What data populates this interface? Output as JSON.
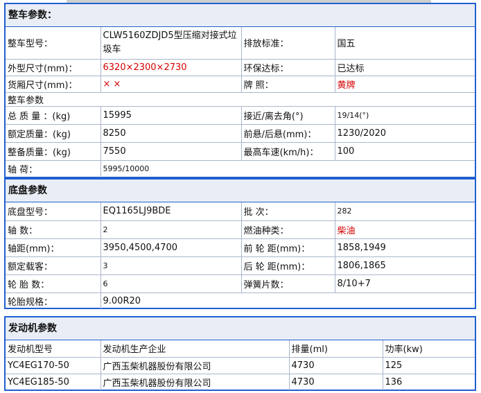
{
  "vehicle": {
    "title": "整车参数：",
    "model_label": "整车型号：",
    "model_value": "CLW5160ZDJD5型压缩对接式垃圾车",
    "emission_label": "排放标准：",
    "emission_value": "国五",
    "dims_label": "外型尺寸(mm)：",
    "dims_value": "6320×2300×2730",
    "env_label": "环保达标：",
    "env_value": "已达标",
    "box_label": "货厢尺寸(mm)：",
    "box_value": "× ×",
    "plate_label": "牌 照：",
    "plate_value": "黄牌",
    "sub_heading": "整车参数",
    "total_mass_label": "总 质 量 ：(kg)",
    "total_mass_value": "15995",
    "angle_label": "接近/离去角(°)",
    "angle_value": "19/14(°)",
    "rated_mass_label": "额定质量：(kg)",
    "rated_mass_value": "8250",
    "overhang_label": "前悬/后悬(mm)：",
    "overhang_value": "1230/2020",
    "curb_mass_label": "整备质量：(kg)",
    "curb_mass_value": "7550",
    "speed_label": "最高车速(km/h)：",
    "speed_value": "100",
    "axle_load_label": "轴 荷：",
    "axle_load_value": "5995/10000"
  },
  "chassis": {
    "title": "底盘参数",
    "model_label": "底盘型号：",
    "model_value": "EQ1165LJ9BDE",
    "batch_label": "批 次：",
    "batch_value": "282",
    "axles_label": "轴 数：",
    "axles_value": "2",
    "fuel_label": "燃油种类：",
    "fuel_value": "柴油",
    "wheelbase_label": "轴距(mm)：",
    "wheelbase_value": "3950,4500,4700",
    "front_track_label": "前 轮 距(mm)：",
    "front_track_value": "1858,1949",
    "passengers_label": "额定载客：",
    "passengers_value": "3",
    "rear_track_label": "后 轮 距(mm)：",
    "rear_track_value": "1806,1865",
    "tires_label": "轮 胎 数：",
    "tires_value": "6",
    "springs_label": "弹簧片数：",
    "springs_value": "8/10+7",
    "tire_spec_label": "轮胎规格：",
    "tire_spec_value": "9.00R20"
  },
  "engine": {
    "title": "发动机参数",
    "headers": [
      "发动机型号",
      "发动机生产企业",
      "排量(ml)",
      "功率(kw)"
    ],
    "rows": [
      [
        "YC4EG170-50",
        "广西玉柴机器股份有限公司",
        "4730",
        "125"
      ],
      [
        "YC4EG185-50",
        "广西玉柴机器股份有限公司",
        "4730",
        "136"
      ]
    ]
  }
}
